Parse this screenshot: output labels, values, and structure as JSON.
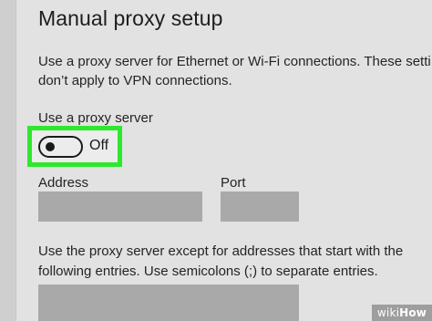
{
  "settings": {
    "title": "Manual proxy setup",
    "description_lines": [
      "Use a proxy server for Ethernet or Wi-Fi connections. These setti",
      "don’t apply to VPN connections."
    ],
    "use_proxy": {
      "label": "Use a proxy server",
      "state_label": "Off",
      "is_on": false
    },
    "address": {
      "label": "Address",
      "value": ""
    },
    "port": {
      "label": "Port",
      "value": ""
    },
    "exceptions": {
      "description_lines": [
        "Use the proxy server except for addresses that start with the",
        "following entries. Use semicolons (;) to separate entries."
      ],
      "value": ""
    }
  },
  "watermark": {
    "part1": "wiki",
    "part2": "How"
  },
  "colors": {
    "highlight": "#2ee82e",
    "panel_background": "#e2e2e2",
    "input_background": "#a9a9a9"
  }
}
